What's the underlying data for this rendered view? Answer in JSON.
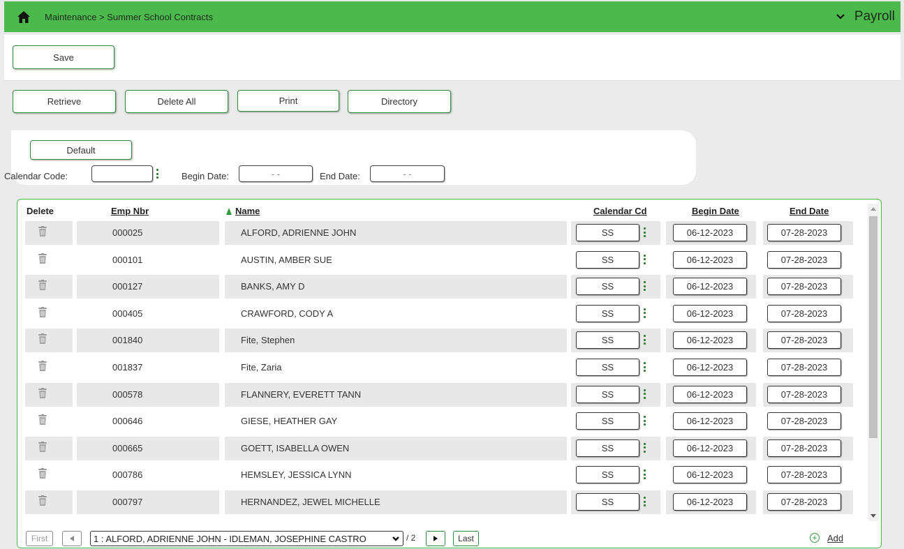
{
  "header": {
    "breadcrumb": "Maintenance > Summer School Contracts",
    "module": "Payroll"
  },
  "toolbar": {
    "save_label": "Save",
    "retrieve_label": "Retrieve",
    "delete_all_label": "Delete All",
    "print_label": "Print",
    "directory_label": "Directory"
  },
  "filters": {
    "default_label": "Default",
    "calendar_code_label": "Calendar Code:",
    "calendar_code_value": "",
    "begin_date_label": "Begin Date:",
    "begin_date_value": "- -",
    "end_date_label": "End Date:",
    "end_date_value": "- -"
  },
  "grid": {
    "columns": {
      "delete": "Delete",
      "emp_nbr": "Emp Nbr",
      "name": "Name",
      "calendar_cd": "Calendar Cd",
      "begin_date": "Begin Date",
      "end_date": "End Date"
    },
    "rows": [
      {
        "emp": "000025",
        "name": "ALFORD, ADRIENNE JOHN",
        "cal": "SS",
        "begin": "06-12-2023",
        "end": "07-28-2023"
      },
      {
        "emp": "000101",
        "name": "AUSTIN, AMBER SUE",
        "cal": "SS",
        "begin": "06-12-2023",
        "end": "07-28-2023"
      },
      {
        "emp": "000127",
        "name": "BANKS, AMY D",
        "cal": "SS",
        "begin": "06-12-2023",
        "end": "07-28-2023"
      },
      {
        "emp": "000405",
        "name": "CRAWFORD, CODY A",
        "cal": "SS",
        "begin": "06-12-2023",
        "end": "07-28-2023"
      },
      {
        "emp": "001840",
        "name": "Fite, Stephen",
        "cal": "SS",
        "begin": "06-12-2023",
        "end": "07-28-2023"
      },
      {
        "emp": "001837",
        "name": "Fite, Zaria",
        "cal": "SS",
        "begin": "06-12-2023",
        "end": "07-28-2023"
      },
      {
        "emp": "000578",
        "name": "FLANNERY, EVERETT TANN",
        "cal": "SS",
        "begin": "06-12-2023",
        "end": "07-28-2023"
      },
      {
        "emp": "000646",
        "name": "GIESE, HEATHER GAY",
        "cal": "SS",
        "begin": "06-12-2023",
        "end": "07-28-2023"
      },
      {
        "emp": "000665",
        "name": "GOETT, ISABELLA OWEN",
        "cal": "SS",
        "begin": "06-12-2023",
        "end": "07-28-2023"
      },
      {
        "emp": "000786",
        "name": "HEMSLEY, JESSICA LYNN",
        "cal": "SS",
        "begin": "06-12-2023",
        "end": "07-28-2023"
      },
      {
        "emp": "000797",
        "name": "HERNANDEZ, JEWEL MICHELLE",
        "cal": "SS",
        "begin": "06-12-2023",
        "end": "07-28-2023"
      }
    ]
  },
  "pager": {
    "first_label": "First",
    "page_select": "1 : ALFORD, ADRIENNE JOHN - IDLEMAN, JOSEPHINE CASTRO",
    "total": "/ 2",
    "last_label": "Last",
    "add_label": "Add"
  },
  "colors": {
    "accent": "#4cb94c",
    "button_border": "#2e8b3a"
  }
}
